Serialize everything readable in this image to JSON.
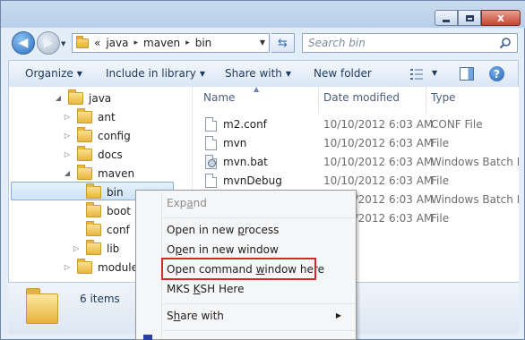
{
  "window": {
    "close_symbol": "x"
  },
  "address_bar": {
    "crumbs": [
      "«",
      "java",
      "maven",
      "bin"
    ],
    "separator": "▸"
  },
  "search": {
    "placeholder": "Search bin"
  },
  "toolbar": {
    "organize": "Organize",
    "include_in_library": "Include in library",
    "share_with": "Share with",
    "new_folder": "New folder",
    "help": "?"
  },
  "nav_tree": [
    {
      "label": "java",
      "toggle": "◢"
    },
    {
      "label": "ant",
      "toggle": "▷"
    },
    {
      "label": "config",
      "toggle": "▷"
    },
    {
      "label": "docs",
      "toggle": "▷"
    },
    {
      "label": "maven",
      "toggle": "◢"
    },
    {
      "label": "bin",
      "toggle": ""
    },
    {
      "label": "boot",
      "toggle": ""
    },
    {
      "label": "conf",
      "toggle": ""
    },
    {
      "label": "lib",
      "toggle": "▷"
    },
    {
      "label": "modules",
      "toggle": "▷"
    }
  ],
  "columns": {
    "name": "Name",
    "date_modified": "Date modified",
    "type": "Type"
  },
  "files": [
    {
      "name": "m2.conf",
      "date": "10/10/2012 6:03 AM",
      "type": "CONF File",
      "icon": "file"
    },
    {
      "name": "mvn",
      "date": "10/10/2012 6:03 AM",
      "type": "File",
      "icon": "file"
    },
    {
      "name": "mvn.bat",
      "date": "10/10/2012 6:03 AM",
      "type": "Windows Batch Fil",
      "icon": "bat"
    },
    {
      "name": "mvnDebug",
      "date": "10/10/2012 6:03 AM",
      "type": "File",
      "icon": "file"
    },
    {
      "name": "",
      "date": "10/10/2012 6:03 AM",
      "type": "Windows Batch Fil",
      "icon": "none"
    },
    {
      "name": "",
      "date": "10/10/2012 6:03 AM",
      "type": "File",
      "icon": "none"
    }
  ],
  "details": {
    "item_count": "6 items"
  },
  "context_menu": {
    "expand_pre": "Exp",
    "expand_key": "a",
    "expand_post": "nd",
    "open_new_process_pre": "Open in new ",
    "open_new_process_key": "p",
    "open_new_process_post": "rocess",
    "open_new_window_pre": "O",
    "open_new_window_key": "p",
    "open_new_window_post": "en in new window",
    "open_cmd_pre": "Open command ",
    "open_cmd_key": "w",
    "open_cmd_post": "indow here",
    "mks_pre": "MKS ",
    "mks_key": "K",
    "mks_post": "SH Here",
    "share_with_pre": "S",
    "share_with_key": "h",
    "share_with_post": "are with",
    "submenu_arrow": "▶"
  },
  "colors": {
    "highlight_box": "#d9282a",
    "selection": "#cfe3f8",
    "accent": "#1e395b"
  }
}
